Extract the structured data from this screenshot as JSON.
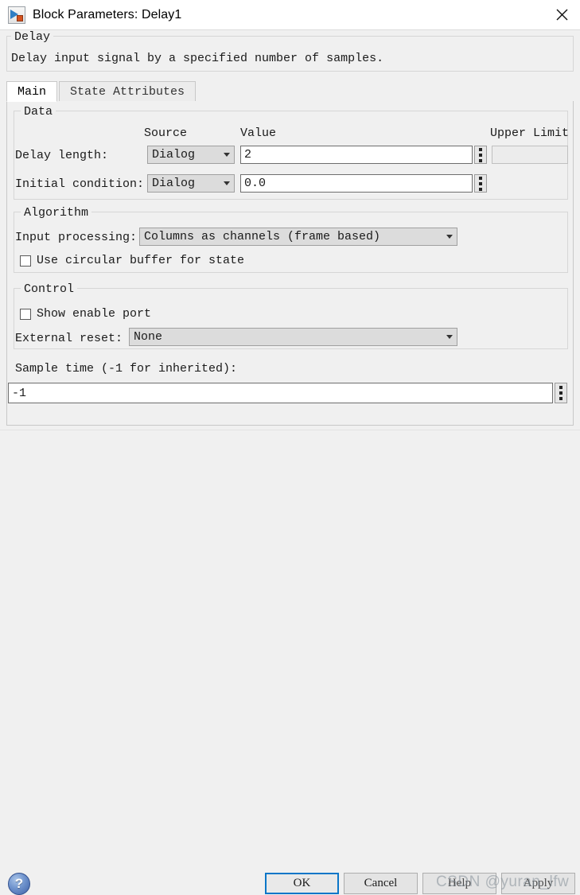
{
  "window": {
    "title": "Block Parameters: Delay1",
    "icon": "simulink-block-icon",
    "close_label": "×"
  },
  "description": {
    "legend": "Delay",
    "text": "Delay input signal by a specified number of samples."
  },
  "tabs": [
    {
      "label": "Main",
      "active": true
    },
    {
      "label": "State Attributes",
      "active": false
    }
  ],
  "data_group": {
    "legend": "Data",
    "columns": {
      "source": "Source",
      "value": "Value",
      "upper_limit": "Upper Limit"
    },
    "rows": [
      {
        "label": "Delay length:",
        "source": "Dialog",
        "value": "2",
        "upper_limit": "",
        "upper_limit_enabled": false
      },
      {
        "label": "Initial condition:",
        "source": "Dialog",
        "value": "0.0",
        "upper_limit": null,
        "upper_limit_enabled": false
      }
    ]
  },
  "algorithm_group": {
    "legend": "Algorithm",
    "input_processing_label": "Input processing:",
    "input_processing_value": "Columns as channels (frame based)",
    "circular_buffer_label": "Use circular buffer for state",
    "circular_buffer_checked": false
  },
  "control_group": {
    "legend": "Control",
    "show_enable_port_label": "Show enable port",
    "show_enable_port_checked": false,
    "external_reset_label": "External reset:",
    "external_reset_value": "None"
  },
  "sample_time": {
    "label": "Sample time (-1 for inherited):",
    "value": "-1"
  },
  "footer": {
    "help_icon_label": "?",
    "buttons": [
      {
        "label": "OK",
        "default": true,
        "enabled": true
      },
      {
        "label": "Cancel",
        "default": false,
        "enabled": true
      },
      {
        "label": "Help",
        "default": false,
        "enabled": true
      },
      {
        "label": "Apply",
        "default": false,
        "enabled": true
      }
    ]
  },
  "watermark": {
    "text": "CSDN @yuran_lfw"
  },
  "colors": {
    "accent": "#0a76c8",
    "window_bg": "#f0f0f0",
    "field_bg": "#ffffff",
    "combo_bg": "#dcdcdc",
    "disabled_bg": "#ececec"
  }
}
